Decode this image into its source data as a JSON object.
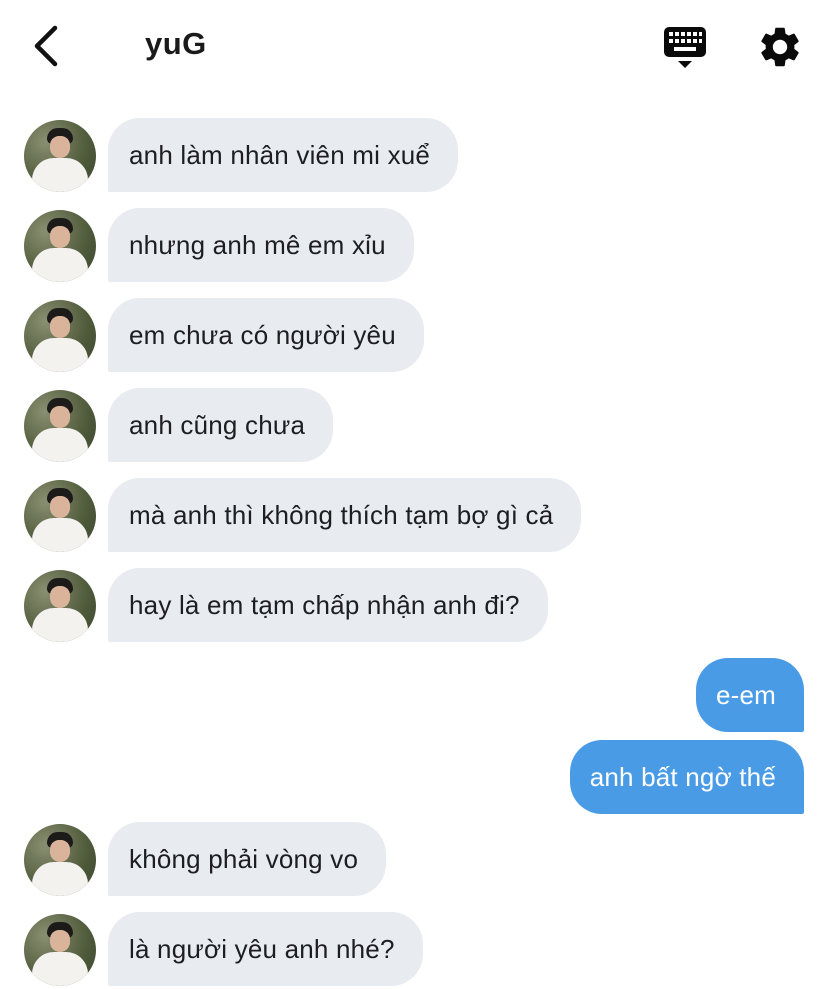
{
  "header": {
    "title": "yuG",
    "back_icon": "chevron-left-icon",
    "keyboard_icon": "keyboard-icon",
    "settings_icon": "gear-icon"
  },
  "colors": {
    "incoming_bubble": "#e8ebef",
    "outgoing_bubble": "#4a9be6",
    "text_dark": "#1c1e21",
    "text_light": "#ffffff"
  },
  "messages": [
    {
      "direction": "in",
      "text": "anh làm nhân viên mi xuể"
    },
    {
      "direction": "in",
      "text": "nhưng anh mê em xỉu"
    },
    {
      "direction": "in",
      "text": "em chưa có người yêu"
    },
    {
      "direction": "in",
      "text": "anh cũng chưa"
    },
    {
      "direction": "in",
      "text": "mà anh thì không thích tạm bợ gì cả"
    },
    {
      "direction": "in",
      "text": "hay là em tạm chấp nhận anh đi?"
    },
    {
      "direction": "out",
      "text": "e-em"
    },
    {
      "direction": "out",
      "text": "anh bất ngờ thế"
    },
    {
      "direction": "in",
      "text": "không phải vòng vo"
    },
    {
      "direction": "in",
      "text": "là người yêu anh nhé?"
    }
  ]
}
